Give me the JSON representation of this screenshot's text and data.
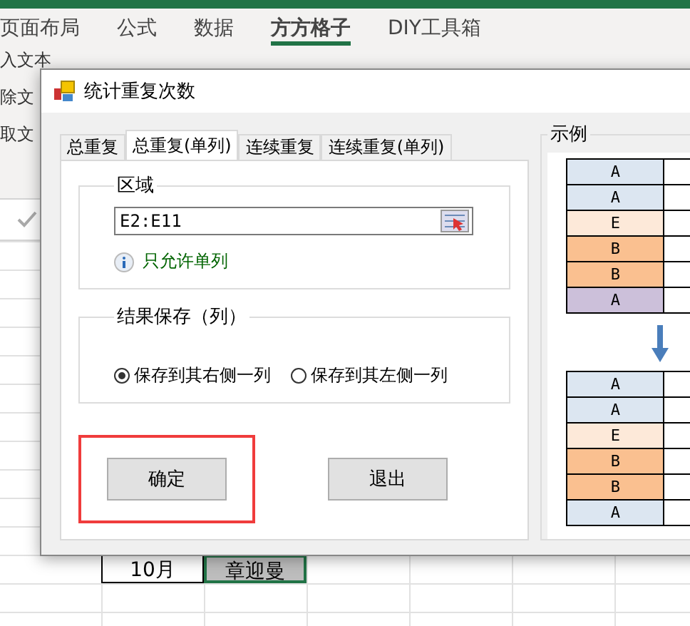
{
  "ribbon_tabs": [
    {
      "label": "页面布局",
      "selected": false
    },
    {
      "label": "公式",
      "selected": false
    },
    {
      "label": "数据",
      "selected": false
    },
    {
      "label": "方方格子",
      "selected": true
    },
    {
      "label": "DIY工具箱",
      "selected": false
    }
  ],
  "ribbon_items": [
    "入文本",
    "除文",
    "取文"
  ],
  "dialog": {
    "title": "统计重复次数",
    "tabs": [
      {
        "label": "总重复",
        "selected": false
      },
      {
        "label": "总重复(单列)",
        "selected": true
      },
      {
        "label": "连续重复",
        "selected": false
      },
      {
        "label": "连续重复(单列)",
        "selected": false
      }
    ],
    "region": {
      "legend": "区域",
      "value": "E2:E11",
      "hint": "只允许单列"
    },
    "save": {
      "legend": "结果保存（列）",
      "options": [
        {
          "label": "保存到其右侧一列",
          "selected": true
        },
        {
          "label": "保存到其左侧一列",
          "selected": false
        }
      ]
    },
    "buttons": [
      {
        "label": "确定",
        "highlighted": true
      },
      {
        "label": "退出",
        "highlighted": false
      }
    ],
    "example": {
      "legend": "示例",
      "before": [
        {
          "text": "A",
          "color": "#dce6f1"
        },
        {
          "text": "A",
          "color": "#dce6f1"
        },
        {
          "text": "E",
          "color": "#fde9d9"
        },
        {
          "text": "B",
          "color": "#fac090"
        },
        {
          "text": "B",
          "color": "#fac090"
        },
        {
          "text": "A",
          "color": "#ccc0da"
        }
      ],
      "after": [
        {
          "text": "A",
          "color": "#dce6f1"
        },
        {
          "text": "A",
          "color": "#dce6f1"
        },
        {
          "text": "E",
          "color": "#fde9d9"
        },
        {
          "text": "B",
          "color": "#fac090"
        },
        {
          "text": "B",
          "color": "#fac090"
        },
        {
          "text": "A",
          "color": "#dce6f1"
        }
      ]
    }
  },
  "sheet_cells": [
    {
      "text": "10月",
      "selected": false
    },
    {
      "text": "章迎曼",
      "selected": true
    }
  ]
}
